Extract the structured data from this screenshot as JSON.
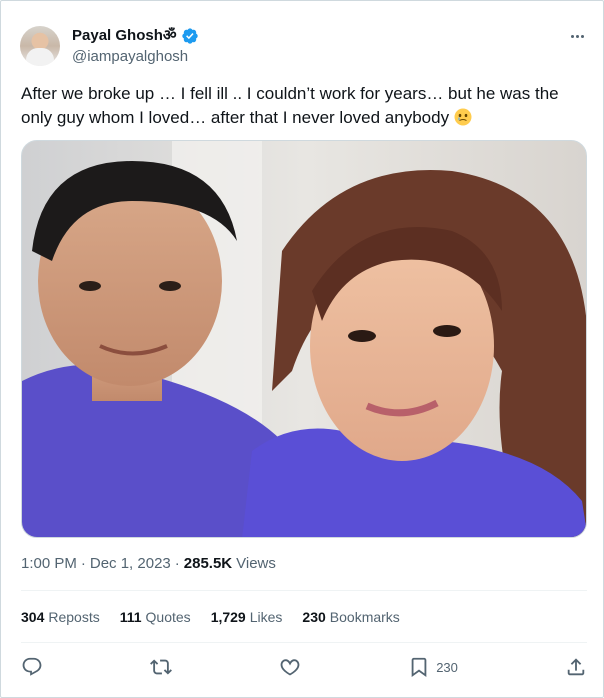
{
  "author": {
    "display_name": "Payal Ghosh",
    "name_symbol": "ॐ",
    "handle": "@iampayalghosh",
    "verified": true
  },
  "tweet": {
    "text": "After we broke up … I fell ill .. I couldn’t work for years… but he was the only guy whom I loved… after that I never loved anybody",
    "emoji": "face-holding-back-tears"
  },
  "meta": {
    "time": "1:00 PM",
    "separator1": "·",
    "date": "Dec 1, 2023",
    "separator2": "·",
    "views_count": "285.5K",
    "views_label": "Views"
  },
  "stats": {
    "reposts": {
      "count": "304",
      "label": "Reposts"
    },
    "quotes": {
      "count": "111",
      "label": "Quotes"
    },
    "likes": {
      "count": "1,729",
      "label": "Likes"
    },
    "bookmarks": {
      "count": "230",
      "label": "Bookmarks"
    }
  },
  "actions": {
    "bookmark_count": "230"
  },
  "colors": {
    "verified_blue": "#1d9bf0",
    "text_primary": "#0f1419",
    "text_secondary": "#536471"
  }
}
